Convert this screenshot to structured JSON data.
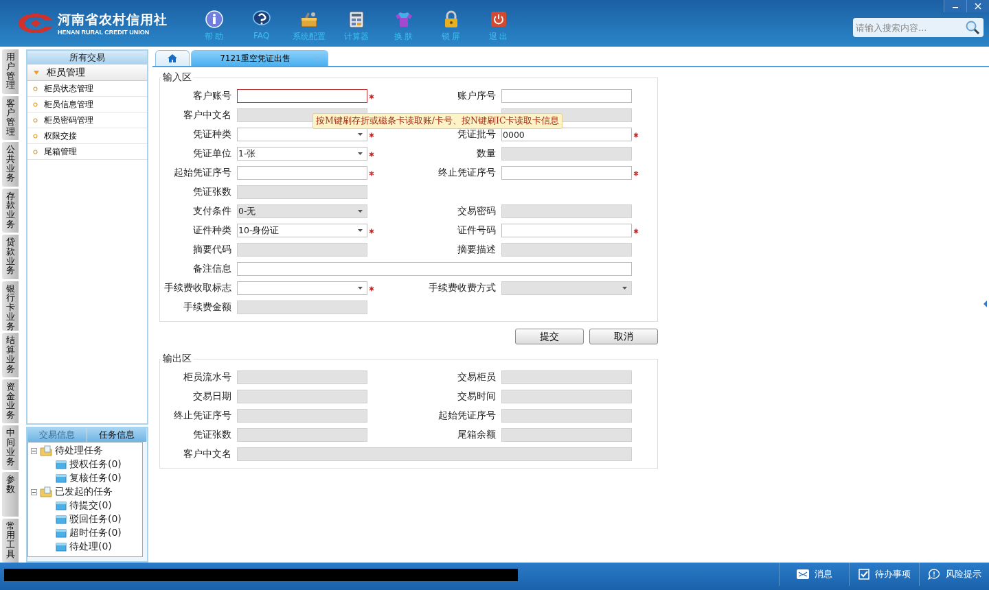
{
  "header": {
    "logo_title": "河南省农村信用社",
    "logo_subtitle": "HENAN RURAL CREDIT UNION",
    "toolbar": [
      {
        "label": "帮 助",
        "kind": "info"
      },
      {
        "label": "FAQ",
        "kind": "question"
      },
      {
        "label": "系统配置",
        "kind": "toolbox"
      },
      {
        "label": "计算器",
        "kind": "calculator"
      },
      {
        "label": "换 肤",
        "kind": "shirt"
      },
      {
        "label": "锁 屏",
        "kind": "lock"
      },
      {
        "label": "退 出",
        "kind": "power"
      }
    ],
    "search": {
      "placeholder": "请输入搜索内容..."
    }
  },
  "side_tabs": [
    "用户管理",
    "客户管理",
    "公共业务",
    "存款业务",
    "贷款业务",
    "银行卡业务",
    "结算业务",
    "资金业务",
    "中间业务",
    "参数",
    "常用工具"
  ],
  "menu": {
    "title": "所有交易",
    "group": {
      "label": "柜员管理",
      "expanded": true,
      "items": [
        "柜员状态管理",
        "柜员信息管理",
        "柜员密码管理",
        "权限交接",
        "尾箱管理"
      ]
    }
  },
  "info_panel": {
    "tabs": [
      {
        "label": "交易信息",
        "selected": false
      },
      {
        "label": "任务信息",
        "selected": true
      }
    ],
    "tree": [
      {
        "label": "待处理任务",
        "expanded": true,
        "children": [
          {
            "label": "授权任务(0)"
          },
          {
            "label": "复核任务(0)"
          }
        ]
      },
      {
        "label": "已发起的任务",
        "expanded": true,
        "children": [
          {
            "label": "待提交(0)"
          },
          {
            "label": "驳回任务(0)"
          },
          {
            "label": "超时任务(0)"
          },
          {
            "label": "待处理(0)"
          }
        ]
      }
    ]
  },
  "tabs": [
    {
      "kind": "home",
      "selected": false
    },
    {
      "kind": "page",
      "label": "7121重空凭证出售",
      "selected": true
    }
  ],
  "input_area": {
    "title": "输入区",
    "rows": [
      [
        {
          "label": "客户账号",
          "kind": "text",
          "required": true,
          "error": true,
          "disabled": false
        },
        {
          "label": "账户序号",
          "kind": "text",
          "required": false,
          "disabled": false
        }
      ],
      [
        {
          "label": "客户中文名",
          "kind": "text",
          "required": false,
          "disabled": true
        },
        {
          "kind": "text",
          "required": false,
          "disabled": true
        }
      ],
      [
        {
          "label": "凭证种类",
          "kind": "select",
          "required": true,
          "disabled": false
        },
        {
          "label": "凭证批号",
          "kind": "text",
          "value": "0000",
          "required": true,
          "disabled": false
        }
      ],
      [
        {
          "label": "凭证单位",
          "kind": "select",
          "value": "1-张",
          "required": true,
          "disabled": false
        },
        {
          "label": "数量",
          "kind": "text",
          "required": false,
          "disabled": true
        }
      ],
      [
        {
          "label": "起始凭证序号",
          "kind": "text",
          "required": true,
          "disabled": false
        },
        {
          "label": "终止凭证序号",
          "kind": "text",
          "required": true,
          "disabled": false
        }
      ],
      [
        {
          "label": "凭证张数",
          "kind": "text",
          "required": false,
          "disabled": true
        }
      ],
      [
        {
          "label": "支付条件",
          "kind": "select",
          "value": "0-无",
          "required": false,
          "disabled": true
        },
        {
          "label": "交易密码",
          "kind": "text",
          "required": false,
          "disabled": true
        }
      ],
      [
        {
          "label": "证件种类",
          "kind": "select",
          "value": "10-身份证",
          "required": true,
          "disabled": false
        },
        {
          "label": "证件号码",
          "kind": "text",
          "required": true,
          "disabled": false
        }
      ],
      [
        {
          "label": "摘要代码",
          "kind": "text",
          "required": false,
          "disabled": true
        },
        {
          "label": "摘要描述",
          "kind": "text",
          "required": false,
          "disabled": true
        }
      ],
      [
        {
          "label": "备注信息",
          "kind": "wide",
          "required": false,
          "disabled": false
        }
      ],
      [
        {
          "label": "手续费收取标志",
          "kind": "select",
          "required": true,
          "disabled": false
        },
        {
          "label": "手续费收费方式",
          "kind": "select",
          "required": false,
          "disabled": true
        }
      ],
      [
        {
          "label": "手续费金额",
          "kind": "text",
          "required": false,
          "disabled": true
        }
      ]
    ],
    "tooltip": "按M键刷存折或磁条卡读取账/卡号、按N键刷IC卡读取卡信息"
  },
  "buttons": [
    "提交",
    "取消"
  ],
  "output_area": {
    "title": "输出区",
    "rows": [
      [
        {
          "label": "柜员流水号",
          "kind": "text",
          "disabled": true
        },
        {
          "label": "交易柜员",
          "kind": "text",
          "disabled": true
        }
      ],
      [
        {
          "label": "交易日期",
          "kind": "text",
          "disabled": true
        },
        {
          "label": "交易时间",
          "kind": "text",
          "disabled": true
        }
      ],
      [
        {
          "label": "终止凭证序号",
          "kind": "text",
          "disabled": true
        },
        {
          "label": "起始凭证序号",
          "kind": "text",
          "disabled": true
        }
      ],
      [
        {
          "label": "凭证张数",
          "kind": "text",
          "disabled": true
        },
        {
          "label": "尾箱余额",
          "kind": "text",
          "disabled": true
        }
      ],
      [
        {
          "label": "客户中文名",
          "kind": "wide",
          "disabled": true
        }
      ]
    ]
  },
  "status_bar": [
    {
      "label": "消息",
      "kind": "mail"
    },
    {
      "label": "待办事项",
      "kind": "check"
    },
    {
      "label": "风险提示",
      "kind": "bubble"
    }
  ]
}
